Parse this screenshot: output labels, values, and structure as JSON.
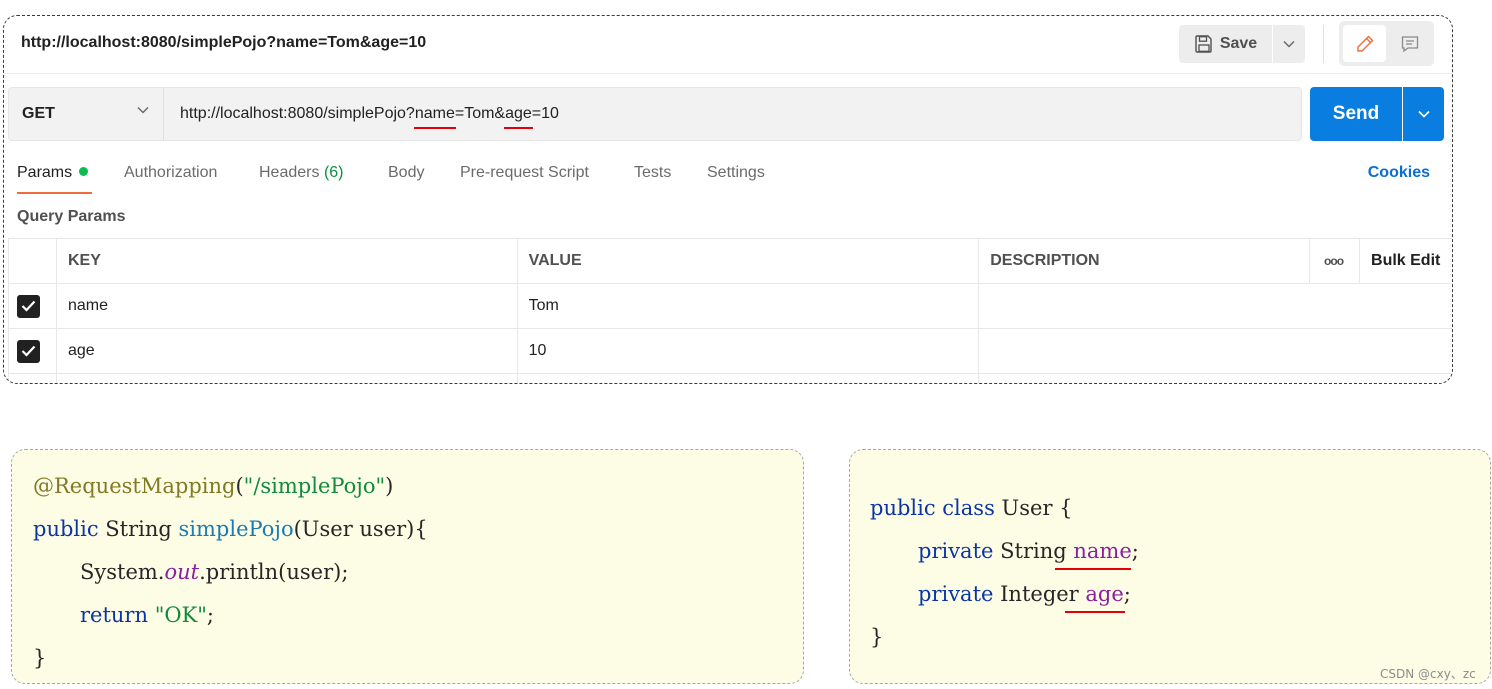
{
  "request": {
    "name": "http://localhost:8080/simplePojo?name=Tom&age=10",
    "method": "GET",
    "url_parts": [
      "http://localhost:8080/simplePojo?",
      "name",
      "=Tom&",
      "age",
      "=10"
    ]
  },
  "toolbar": {
    "save_label": "Save",
    "save_icon": "floppy-disk-icon",
    "edit_icon": "pencil-icon",
    "comment_icon": "comment-icon"
  },
  "send": {
    "label": "Send"
  },
  "tabs": [
    {
      "label": "Params"
    },
    {
      "label": "Authorization"
    },
    {
      "label": "Headers",
      "count": "(6)"
    },
    {
      "label": "Body"
    },
    {
      "label": "Pre-request Script"
    },
    {
      "label": "Tests"
    },
    {
      "label": "Settings"
    }
  ],
  "cookies_label": "Cookies",
  "query_params": {
    "title": "Query Params",
    "columns": [
      "KEY",
      "VALUE",
      "DESCRIPTION"
    ],
    "more_label": "ooo",
    "bulk_edit_label": "Bulk Edit",
    "rows": [
      {
        "key": "name",
        "value": "Tom",
        "description": "",
        "checked": true
      },
      {
        "key": "age",
        "value": "10",
        "description": "",
        "checked": true
      }
    ]
  },
  "controller_code": {
    "annotation": "@RequestMapping",
    "open_paren": "(",
    "path": "\"/simplePojo\"",
    "close_paren": ")",
    "kw_public": "public",
    "ret_type": " String ",
    "method_name": "simplePojo",
    "params": "(User user){",
    "sys": "System.",
    "out": "out",
    "println": ".println(user);",
    "kw_return": "return",
    "ret_val": "\"OK\"",
    "semi": ";",
    "close": "}"
  },
  "user_code": {
    "kw_public": "public",
    "kw_class": "class",
    "class_decl": " User {",
    "kw_private": "private",
    "t_string": " String ",
    "f_name": "name",
    "t_integer": " Integer ",
    "f_age": "age",
    "semi": ";",
    "close": "}"
  },
  "colors": {
    "accent_blue": "#0a7de0",
    "active_tab_underline": "#f26b3a",
    "params_dot": "#0cbb52",
    "highlight_red": "#e3000b",
    "code_bg": "#fdfde6"
  },
  "watermark": "CSDN @cxy、zc"
}
